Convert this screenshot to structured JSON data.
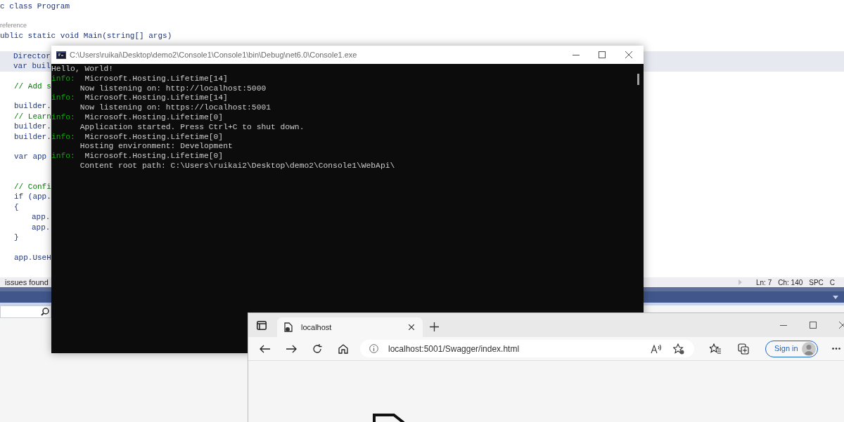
{
  "editor": {
    "lines": [
      {
        "text": "c class Program",
        "kind": "code",
        "current": false
      },
      {
        "text": "reference",
        "kind": "codelens",
        "current": false
      },
      {
        "text": "ublic static void Main(string[] args)",
        "kind": "code",
        "current": false
      },
      {
        "text": "Director",
        "kind": "code",
        "current": true
      },
      {
        "text": "var buil",
        "kind": "code",
        "current": true
      },
      {
        "text": "// Add s",
        "kind": "comment",
        "current": false
      },
      {
        "text": "builder.",
        "kind": "code",
        "current": false
      },
      {
        "text": "// Learn",
        "kind": "comment",
        "current": false
      },
      {
        "text": "builder.",
        "kind": "code",
        "current": false
      },
      {
        "text": "builder.",
        "kind": "code",
        "current": false
      },
      {
        "text": "var app",
        "kind": "code",
        "current": false
      },
      {
        "text": "// Confi",
        "kind": "comment",
        "current": false
      },
      {
        "text": "if (app.",
        "kind": "code",
        "current": false
      },
      {
        "text": "{",
        "kind": "code",
        "current": false
      },
      {
        "text": "app.",
        "kind": "code",
        "current": false
      },
      {
        "text": "app.",
        "kind": "code",
        "current": false
      },
      {
        "text": "}",
        "kind": "code",
        "current": false
      },
      {
        "text": "app.UseH",
        "kind": "code",
        "current": false
      }
    ]
  },
  "status_bar": {
    "issues": "issues found",
    "items": [
      "Ln: 7",
      "Ch: 140",
      "SPC",
      "C"
    ]
  },
  "console": {
    "title": "C:\\Users\\ruikai\\Desktop\\demo2\\Console1\\Console1\\bin\\Debug\\net6.0\\Console1.exe",
    "lines": [
      {
        "kind": "plain",
        "text": "Hello, World!"
      },
      {
        "kind": "log",
        "prefix": "info:",
        "text": "Microsoft.Hosting.Lifetime[14]"
      },
      {
        "kind": "detail",
        "text": "Now listening on: http://localhost:5000"
      },
      {
        "kind": "log",
        "prefix": "info:",
        "text": "Microsoft.Hosting.Lifetime[14]"
      },
      {
        "kind": "detail",
        "text": "Now listening on: https://localhost:5001"
      },
      {
        "kind": "log",
        "prefix": "info:",
        "text": "Microsoft.Hosting.Lifetime[0]"
      },
      {
        "kind": "detail",
        "text": "Application started. Press Ctrl+C to shut down."
      },
      {
        "kind": "log",
        "prefix": "info:",
        "text": "Microsoft.Hosting.Lifetime[0]"
      },
      {
        "kind": "detail",
        "text": "Hosting environment: Development"
      },
      {
        "kind": "log",
        "prefix": "info:",
        "text": "Microsoft.Hosting.Lifetime[0]"
      },
      {
        "kind": "detail",
        "text": "Content root path: C:\\Users\\ruikai2\\Desktop\\demo2\\Console1\\WebApi\\"
      }
    ]
  },
  "browser": {
    "tab": {
      "title": "localhost",
      "selected": true
    },
    "address": "localhost:5001/Swagger/index.html",
    "sign_in": "Sign in"
  }
}
